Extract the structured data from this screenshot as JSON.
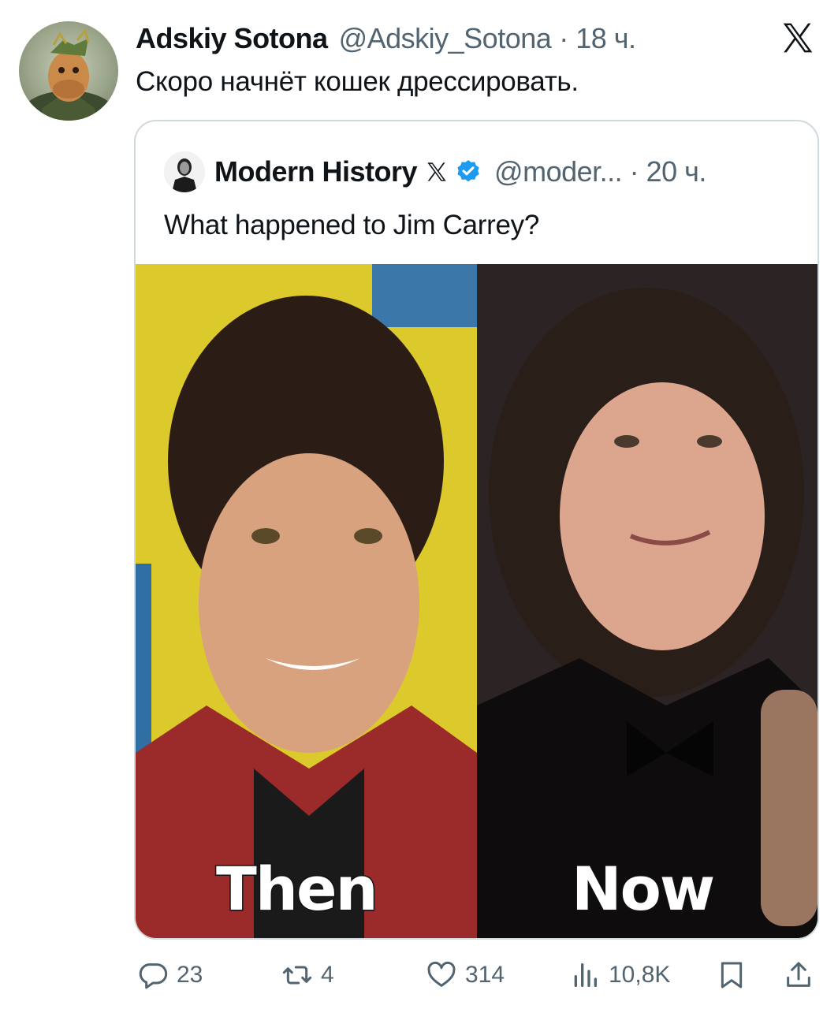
{
  "tweet": {
    "author_name": "Adskiy Sotona",
    "author_handle": "@Adskiy_Sotona",
    "time": "· 18 ч.",
    "text": "Скоро начнёт кошек дрессировать."
  },
  "quoted": {
    "author_name": "Modern History",
    "author_handle": "@moder... · 20 ч.",
    "text": "What happened to Jim Carrey?",
    "caption_left": "Then",
    "caption_right": "Now"
  },
  "stats": {
    "replies": "23",
    "retweets": "4",
    "likes": "314",
    "views": "10,8K"
  },
  "colors": {
    "verified": "#1d9bf0",
    "muted": "#536471",
    "border": "#cfd9de"
  },
  "icons": [
    "x-logo-icon",
    "verified-badge-icon",
    "reply-icon",
    "retweet-icon",
    "like-icon",
    "views-icon",
    "bookmark-icon",
    "share-icon"
  ]
}
